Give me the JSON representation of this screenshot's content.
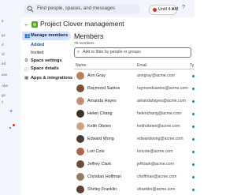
{
  "search": {
    "placeholder": "Find people, spaces, and messages"
  },
  "status": {
    "label": "Until 4 AM",
    "color": "#d93025"
  },
  "rail": {
    "fragments": [
      "5",
      "ps",
      "d",
      "id",
      "ed",
      "ave",
      "Abe",
      "gn",
      "y"
    ]
  },
  "header": {
    "title": "Project Clover management"
  },
  "nav": {
    "manage_members": "Manage members",
    "added": "Added",
    "invited": "Invited",
    "space_settings": "Space settings",
    "space_details": "Space details",
    "apps": "Apps & integrations"
  },
  "members": {
    "title": "Members",
    "count": "78 members",
    "filter_placeholder": "Add or filter by people or groups",
    "columns": {
      "name": "Name",
      "email": "Email",
      "type": "Ty"
    },
    "rows": [
      {
        "name": "Ann Gray",
        "email": "anngray@acme.com",
        "avatar": "#b5845a"
      },
      {
        "name": "Raymond Santos",
        "email": "raymondsantos@acme.com",
        "avatar": "#7a5238"
      },
      {
        "name": "Amanda Hayes",
        "email": "amandahayes@acme.com",
        "avatar": "#c78b7a"
      },
      {
        "name": "Helen Chang",
        "email": "helenchang@acme.com",
        "avatar": "#3c2f2a"
      },
      {
        "name": "Keith Obrien",
        "email": "keithobrien@acme.com",
        "avatar": "#d0a27f"
      },
      {
        "name": "Edward Wong",
        "email": "edwardwong@acme.com",
        "avatar": "#4a3b34"
      },
      {
        "name": "Lori Cole",
        "email": "loricole@acme.com",
        "avatar": "#a8684e"
      },
      {
        "name": "Jeffrey Clark",
        "email": "jeffclark@acme.com",
        "avatar": "#6b4d3a"
      },
      {
        "name": "Christian Hoffman",
        "email": "choffman@acme.com",
        "avatar": "#9a7b62"
      },
      {
        "name": "Shirley Franklin",
        "email": "sfranklin@acme.com",
        "avatar": "#5e3f33"
      }
    ]
  }
}
